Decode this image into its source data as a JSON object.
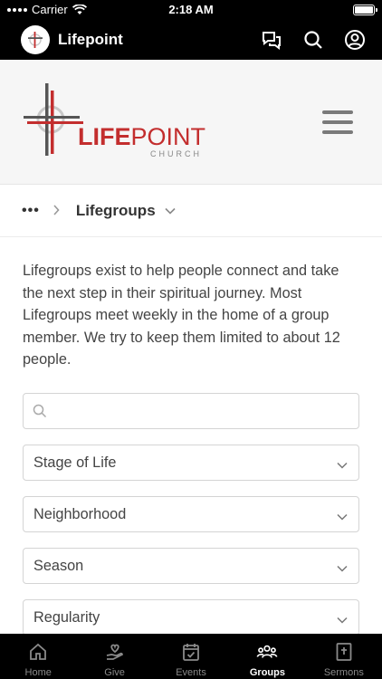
{
  "status_bar": {
    "carrier": "Carrier",
    "time": "2:18 AM"
  },
  "app_header": {
    "title": "Lifepoint",
    "icons": [
      "chat-icon",
      "search-icon",
      "account-icon"
    ]
  },
  "banner": {
    "logo_word_bold": "LIFE",
    "logo_word_rest": "POINT",
    "logo_sub": "CHURCH"
  },
  "breadcrumb": {
    "overflow": "•••",
    "current": "Lifegroups"
  },
  "intro_text": "Lifegroups exist to help people connect and take the next step in their spiritual journey. Most Lifegroups meet weekly in the home of a group member. We try to keep them limited to about 12 people.",
  "search": {
    "placeholder": "",
    "value": ""
  },
  "filters": [
    {
      "label": "Stage of Life"
    },
    {
      "label": "Neighborhood"
    },
    {
      "label": "Season"
    },
    {
      "label": "Regularity"
    }
  ],
  "tabs": [
    {
      "label": "Home",
      "icon": "home-icon"
    },
    {
      "label": "Give",
      "icon": "give-icon"
    },
    {
      "label": "Events",
      "icon": "calendar-icon"
    },
    {
      "label": "Groups",
      "icon": "groups-icon",
      "active": true
    },
    {
      "label": "Sermons",
      "icon": "bible-icon"
    }
  ],
  "colors": {
    "brand_red": "#c32e2e",
    "bar_black": "#000000"
  }
}
